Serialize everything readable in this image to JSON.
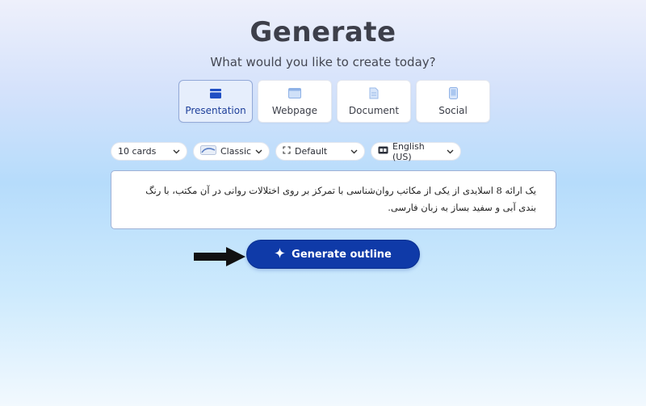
{
  "header": {
    "title": "Generate",
    "subtitle": "What would you like to create today?"
  },
  "content_types": [
    {
      "label": "Presentation",
      "icon": "presentation-icon",
      "selected": true
    },
    {
      "label": "Webpage",
      "icon": "webpage-icon",
      "selected": false
    },
    {
      "label": "Document",
      "icon": "document-icon",
      "selected": false
    },
    {
      "label": "Social",
      "icon": "social-icon",
      "selected": false
    }
  ],
  "options": {
    "cards": "10 cards",
    "theme": "Classic",
    "layout": "Default",
    "language": "English (US)"
  },
  "prompt": {
    "value": "یک ارائه 8 اسلایدی از یکی از مکاتب روان‌شناسی با تمرکز بر روی اختلالات روانی در آن مکتب، با رنگ بندی آبی و سفید بساز به زبان فارسی."
  },
  "actions": {
    "generate_label": "Generate outline"
  },
  "colors": {
    "accent": "#0f3aa8",
    "selected_bg": "#e6eefc",
    "selected_border": "#93a9d8"
  }
}
